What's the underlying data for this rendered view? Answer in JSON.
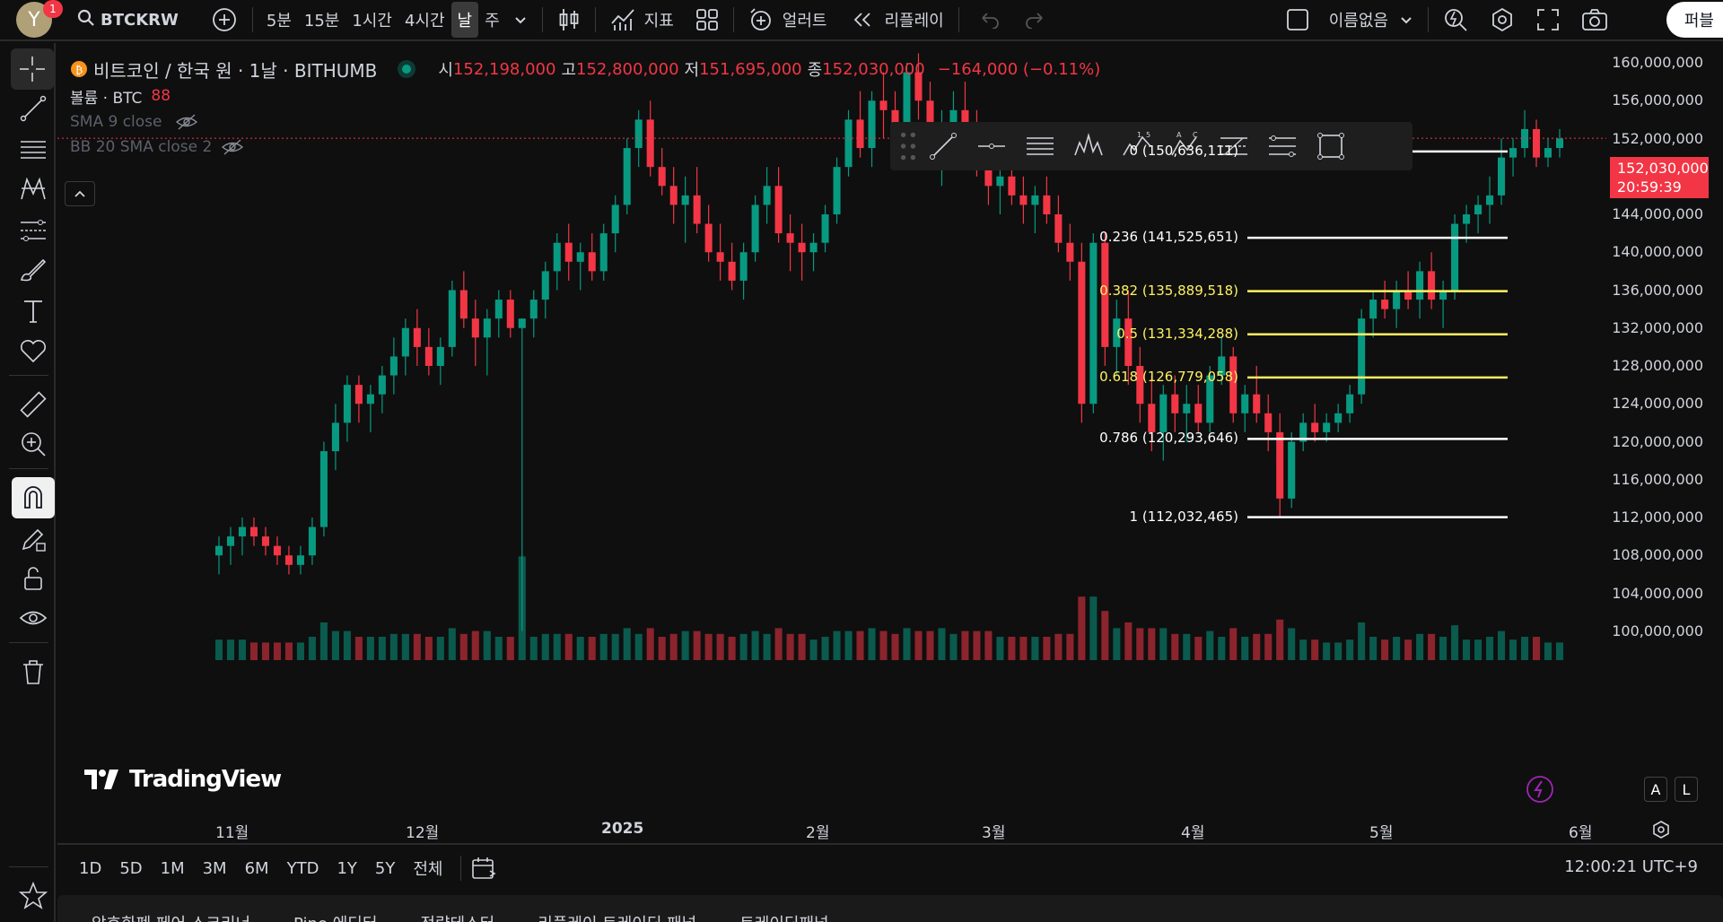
{
  "topbar": {
    "avatar_letter": "Y",
    "notification_count": "1",
    "symbol": "BTCKRW",
    "timeframes": [
      "5분",
      "15분",
      "1시간",
      "4시간",
      "날",
      "주"
    ],
    "active_timeframe": "날",
    "indicators_label": "지표",
    "alert_label": "얼러트",
    "replay_label": "리플레이",
    "layout_name": "이름없음",
    "publish_label": "퍼블"
  },
  "legend": {
    "title": "비트코인 / 한국 원 · 1날 · BITHUMB",
    "open_label": "시",
    "open": "152,198,000",
    "high_label": "고",
    "high": "152,800,000",
    "low_label": "저",
    "low": "151,695,000",
    "close_label": "종",
    "close": "152,030,000",
    "change": "−164,000 (−0.11%)",
    "volume_label": "볼륨 · BTC",
    "volume_value": "88",
    "sma_label": "SMA 9 close",
    "bb_label": "BB 20 SMA close 2"
  },
  "price_axis": {
    "labels": [
      "160,000,000",
      "156,000,000",
      "152,000,000",
      "148,000,000",
      "144,000,000",
      "140,000,000",
      "136,000,000",
      "132,000,000",
      "128,000,000",
      "124,000,000",
      "120,000,000",
      "116,000,000",
      "112,000,000",
      "108,000,000",
      "104,000,000",
      "100,000,000"
    ],
    "current_price": "152,030,000",
    "countdown": "20:59:39"
  },
  "fibonacci": [
    {
      "label": "0 (150,636,111)",
      "price": 150636111,
      "color": "#ffffff"
    },
    {
      "label": "0.236 (141,525,651)",
      "price": 141525651,
      "color": "#ffffff"
    },
    {
      "label": "0.382 (135,889,518)",
      "price": 135889518,
      "color": "#fff263"
    },
    {
      "label": "0.5 (131,334,288)",
      "price": 131334288,
      "color": "#fff263"
    },
    {
      "label": "0.618 (126,779,058)",
      "price": 126779058,
      "color": "#fff263"
    },
    {
      "label": "0.786 (120,293,646)",
      "price": 120293646,
      "color": "#ffffff"
    },
    {
      "label": "1 (112,032,465)",
      "price": 112032465,
      "color": "#ffffff"
    }
  ],
  "time_axis": [
    "11월",
    "12월",
    "2025",
    "2월",
    "3월",
    "4월",
    "5월",
    "6월"
  ],
  "logo_text": "TradingView",
  "axis_buttons": {
    "auto": "A",
    "log": "L"
  },
  "range_buttons": [
    "1D",
    "5D",
    "1M",
    "3M",
    "6M",
    "YTD",
    "1Y",
    "5Y",
    "전체"
  ],
  "clock": "12:00:21 UTC+9",
  "bottom_tabs": [
    "암호화폐 페어 스크리너",
    "Pine 에디터",
    "전략테스터",
    "리플레이 트레이딩 패널",
    "트레이딩패널"
  ],
  "colors": {
    "up": "#089981",
    "down": "#f23645",
    "background": "#0f0f0f",
    "fib_white": "#ffffff",
    "fib_yellow": "#fff263"
  },
  "chart_data": {
    "type": "candlestick",
    "symbol": "BTCKRW",
    "ylim": [
      100000000,
      162000000
    ],
    "candles": [
      [
        108,
        110,
        106,
        109
      ],
      [
        109,
        111,
        107,
        110
      ],
      [
        110,
        112,
        108,
        111
      ],
      [
        111,
        112,
        109,
        110
      ],
      [
        110,
        111,
        108,
        109
      ],
      [
        109,
        110,
        107,
        108
      ],
      [
        108,
        109,
        106,
        107
      ],
      [
        107,
        109,
        106,
        108
      ],
      [
        108,
        112,
        107,
        111
      ],
      [
        111,
        120,
        110,
        119
      ],
      [
        119,
        124,
        117,
        122
      ],
      [
        122,
        127,
        120,
        126
      ],
      [
        126,
        127,
        122,
        124
      ],
      [
        124,
        126,
        121,
        125
      ],
      [
        125,
        128,
        123,
        127
      ],
      [
        127,
        131,
        125,
        129
      ],
      [
        129,
        133,
        127,
        132
      ],
      [
        132,
        134,
        128,
        130
      ],
      [
        130,
        132,
        127,
        128
      ],
      [
        128,
        131,
        126,
        130
      ],
      [
        130,
        137,
        129,
        136
      ],
      [
        136,
        138,
        132,
        133
      ],
      [
        133,
        135,
        128,
        131
      ],
      [
        131,
        134,
        127,
        133
      ],
      [
        133,
        136,
        131,
        135
      ],
      [
        135,
        136,
        131,
        132
      ],
      [
        132,
        133,
        100,
        133
      ],
      [
        133,
        136,
        131,
        135
      ],
      [
        135,
        139,
        133,
        138
      ],
      [
        138,
        142,
        136,
        141
      ],
      [
        141,
        143,
        137,
        139
      ],
      [
        139,
        141,
        136,
        140
      ],
      [
        140,
        142,
        137,
        138
      ],
      [
        138,
        143,
        137,
        142
      ],
      [
        142,
        146,
        140,
        145
      ],
      [
        145,
        152,
        144,
        151
      ],
      [
        151,
        155,
        149,
        154
      ],
      [
        154,
        156,
        148,
        149
      ],
      [
        149,
        151,
        146,
        147
      ],
      [
        147,
        149,
        143,
        145
      ],
      [
        145,
        148,
        141,
        146
      ],
      [
        146,
        149,
        142,
        143
      ],
      [
        143,
        145,
        139,
        140
      ],
      [
        140,
        143,
        137,
        139
      ],
      [
        139,
        141,
        136,
        137
      ],
      [
        137,
        141,
        135,
        140
      ],
      [
        140,
        146,
        139,
        145
      ],
      [
        145,
        149,
        143,
        147
      ],
      [
        147,
        149,
        141,
        142
      ],
      [
        142,
        144,
        138,
        141
      ],
      [
        141,
        143,
        137,
        140
      ],
      [
        140,
        142,
        138,
        141
      ],
      [
        141,
        145,
        140,
        144
      ],
      [
        144,
        150,
        143,
        149
      ],
      [
        149,
        155,
        148,
        154
      ],
      [
        154,
        157,
        150,
        151
      ],
      [
        151,
        157,
        149,
        156
      ],
      [
        156,
        159,
        152,
        155
      ],
      [
        155,
        157,
        151,
        153
      ],
      [
        153,
        160,
        152,
        159
      ],
      [
        159,
        161,
        154,
        156
      ],
      [
        156,
        158,
        151,
        152
      ],
      [
        152,
        155,
        147,
        153
      ],
      [
        153,
        157,
        151,
        155
      ],
      [
        155,
        158,
        151,
        153
      ],
      [
        153,
        155,
        148,
        150
      ],
      [
        150,
        152,
        145,
        147
      ],
      [
        147,
        149,
        144,
        148
      ],
      [
        148,
        150,
        145,
        146
      ],
      [
        146,
        148,
        143,
        145
      ],
      [
        145,
        147,
        142,
        146
      ],
      [
        146,
        148,
        143,
        144
      ],
      [
        144,
        146,
        140,
        141
      ],
      [
        141,
        143,
        137,
        139
      ],
      [
        139,
        141,
        122,
        124
      ],
      [
        124,
        142,
        123,
        141
      ],
      [
        141,
        142,
        128,
        130
      ],
      [
        130,
        135,
        127,
        133
      ],
      [
        133,
        136,
        126,
        128
      ],
      [
        128,
        130,
        122,
        124
      ],
      [
        124,
        127,
        119,
        121
      ],
      [
        121,
        126,
        118,
        125
      ],
      [
        125,
        127,
        121,
        123
      ],
      [
        123,
        126,
        120,
        124
      ],
      [
        124,
        126,
        121,
        122
      ],
      [
        122,
        128,
        121,
        127
      ],
      [
        127,
        131,
        126,
        129
      ],
      [
        129,
        130,
        122,
        123
      ],
      [
        123,
        126,
        121,
        125
      ],
      [
        125,
        128,
        122,
        123
      ],
      [
        123,
        125,
        119,
        121
      ],
      [
        121,
        123,
        112,
        114
      ],
      [
        114,
        121,
        113,
        120
      ],
      [
        120,
        123,
        119,
        122
      ],
      [
        122,
        124,
        120,
        121
      ],
      [
        121,
        123,
        120,
        122
      ],
      [
        122,
        124,
        121,
        123
      ],
      [
        123,
        126,
        122,
        125
      ],
      [
        125,
        134,
        124,
        133
      ],
      [
        133,
        136,
        131,
        135
      ],
      [
        135,
        137,
        133,
        134
      ],
      [
        134,
        137,
        132,
        136
      ],
      [
        136,
        138,
        134,
        135
      ],
      [
        135,
        139,
        133,
        138
      ],
      [
        138,
        140,
        134,
        135
      ],
      [
        135,
        137,
        132,
        136
      ],
      [
        136,
        144,
        135,
        143
      ],
      [
        143,
        145,
        141,
        144
      ],
      [
        144,
        146,
        142,
        145
      ],
      [
        145,
        148,
        143,
        146
      ],
      [
        146,
        152,
        145,
        150
      ],
      [
        150,
        152,
        148,
        151
      ],
      [
        151,
        155,
        150,
        153
      ],
      [
        153,
        154,
        149,
        150
      ],
      [
        150,
        152,
        149,
        151
      ],
      [
        151,
        153,
        150,
        152
      ]
    ]
  }
}
